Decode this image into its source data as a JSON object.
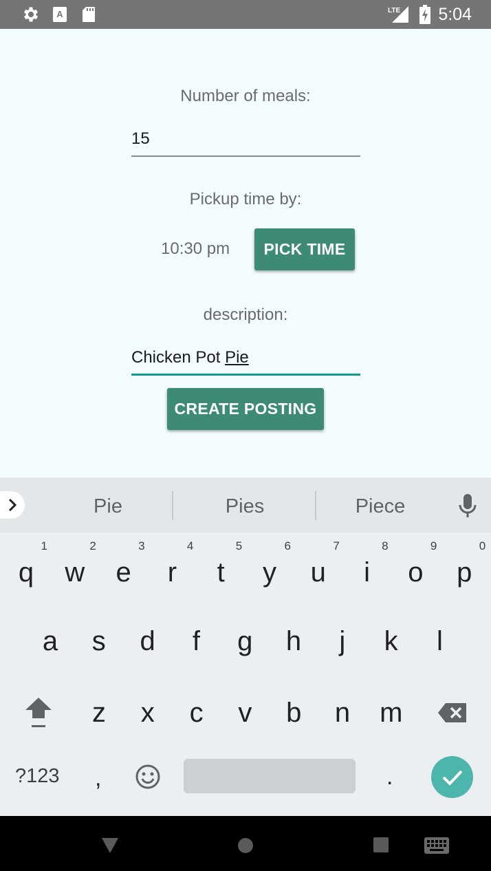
{
  "status_bar": {
    "time": "5:04",
    "network": "LTE",
    "icons": [
      "gear-icon",
      "a-notification-icon",
      "sd-card-icon",
      "signal-icon",
      "battery-charging-icon"
    ]
  },
  "form": {
    "meals_label": "Number of meals:",
    "meals_value": "15",
    "pickup_label": "Pickup time by:",
    "pickup_time": "10:30 pm",
    "pick_time_button": "PICK TIME",
    "description_label": "description:",
    "description_prefix": "Chicken Pot ",
    "description_composing": "Pie",
    "create_button": "CREATE POSTING"
  },
  "keyboard": {
    "suggestions": [
      "Pie",
      "Pies",
      "Piece"
    ],
    "row1": [
      {
        "key": "q",
        "num": "1"
      },
      {
        "key": "w",
        "num": "2"
      },
      {
        "key": "e",
        "num": "3"
      },
      {
        "key": "r",
        "num": "4"
      },
      {
        "key": "t",
        "num": "5"
      },
      {
        "key": "y",
        "num": "6"
      },
      {
        "key": "u",
        "num": "7"
      },
      {
        "key": "i",
        "num": "8"
      },
      {
        "key": "o",
        "num": "9"
      },
      {
        "key": "p",
        "num": "0"
      }
    ],
    "row2": [
      "a",
      "s",
      "d",
      "f",
      "g",
      "h",
      "j",
      "k",
      "l"
    ],
    "row3": [
      "z",
      "x",
      "c",
      "v",
      "b",
      "n",
      "m"
    ],
    "symbols_key": "?123",
    "comma_key": ",",
    "period_key": ".",
    "icons": [
      "shift-icon",
      "backspace-icon",
      "emoji-icon",
      "enter-check-icon",
      "mic-icon",
      "expand-suggestions-icon"
    ]
  },
  "nav_bar": {
    "icons": [
      "back-triangle-icon",
      "home-circle-icon",
      "recents-square-icon",
      "keyboard-switch-icon"
    ]
  },
  "colors": {
    "accent": "#3d8a77",
    "field_focus": "#0f9b8e",
    "enter_key": "#4db6ac",
    "background": "#f3fcff",
    "status_bar": "#757575"
  }
}
